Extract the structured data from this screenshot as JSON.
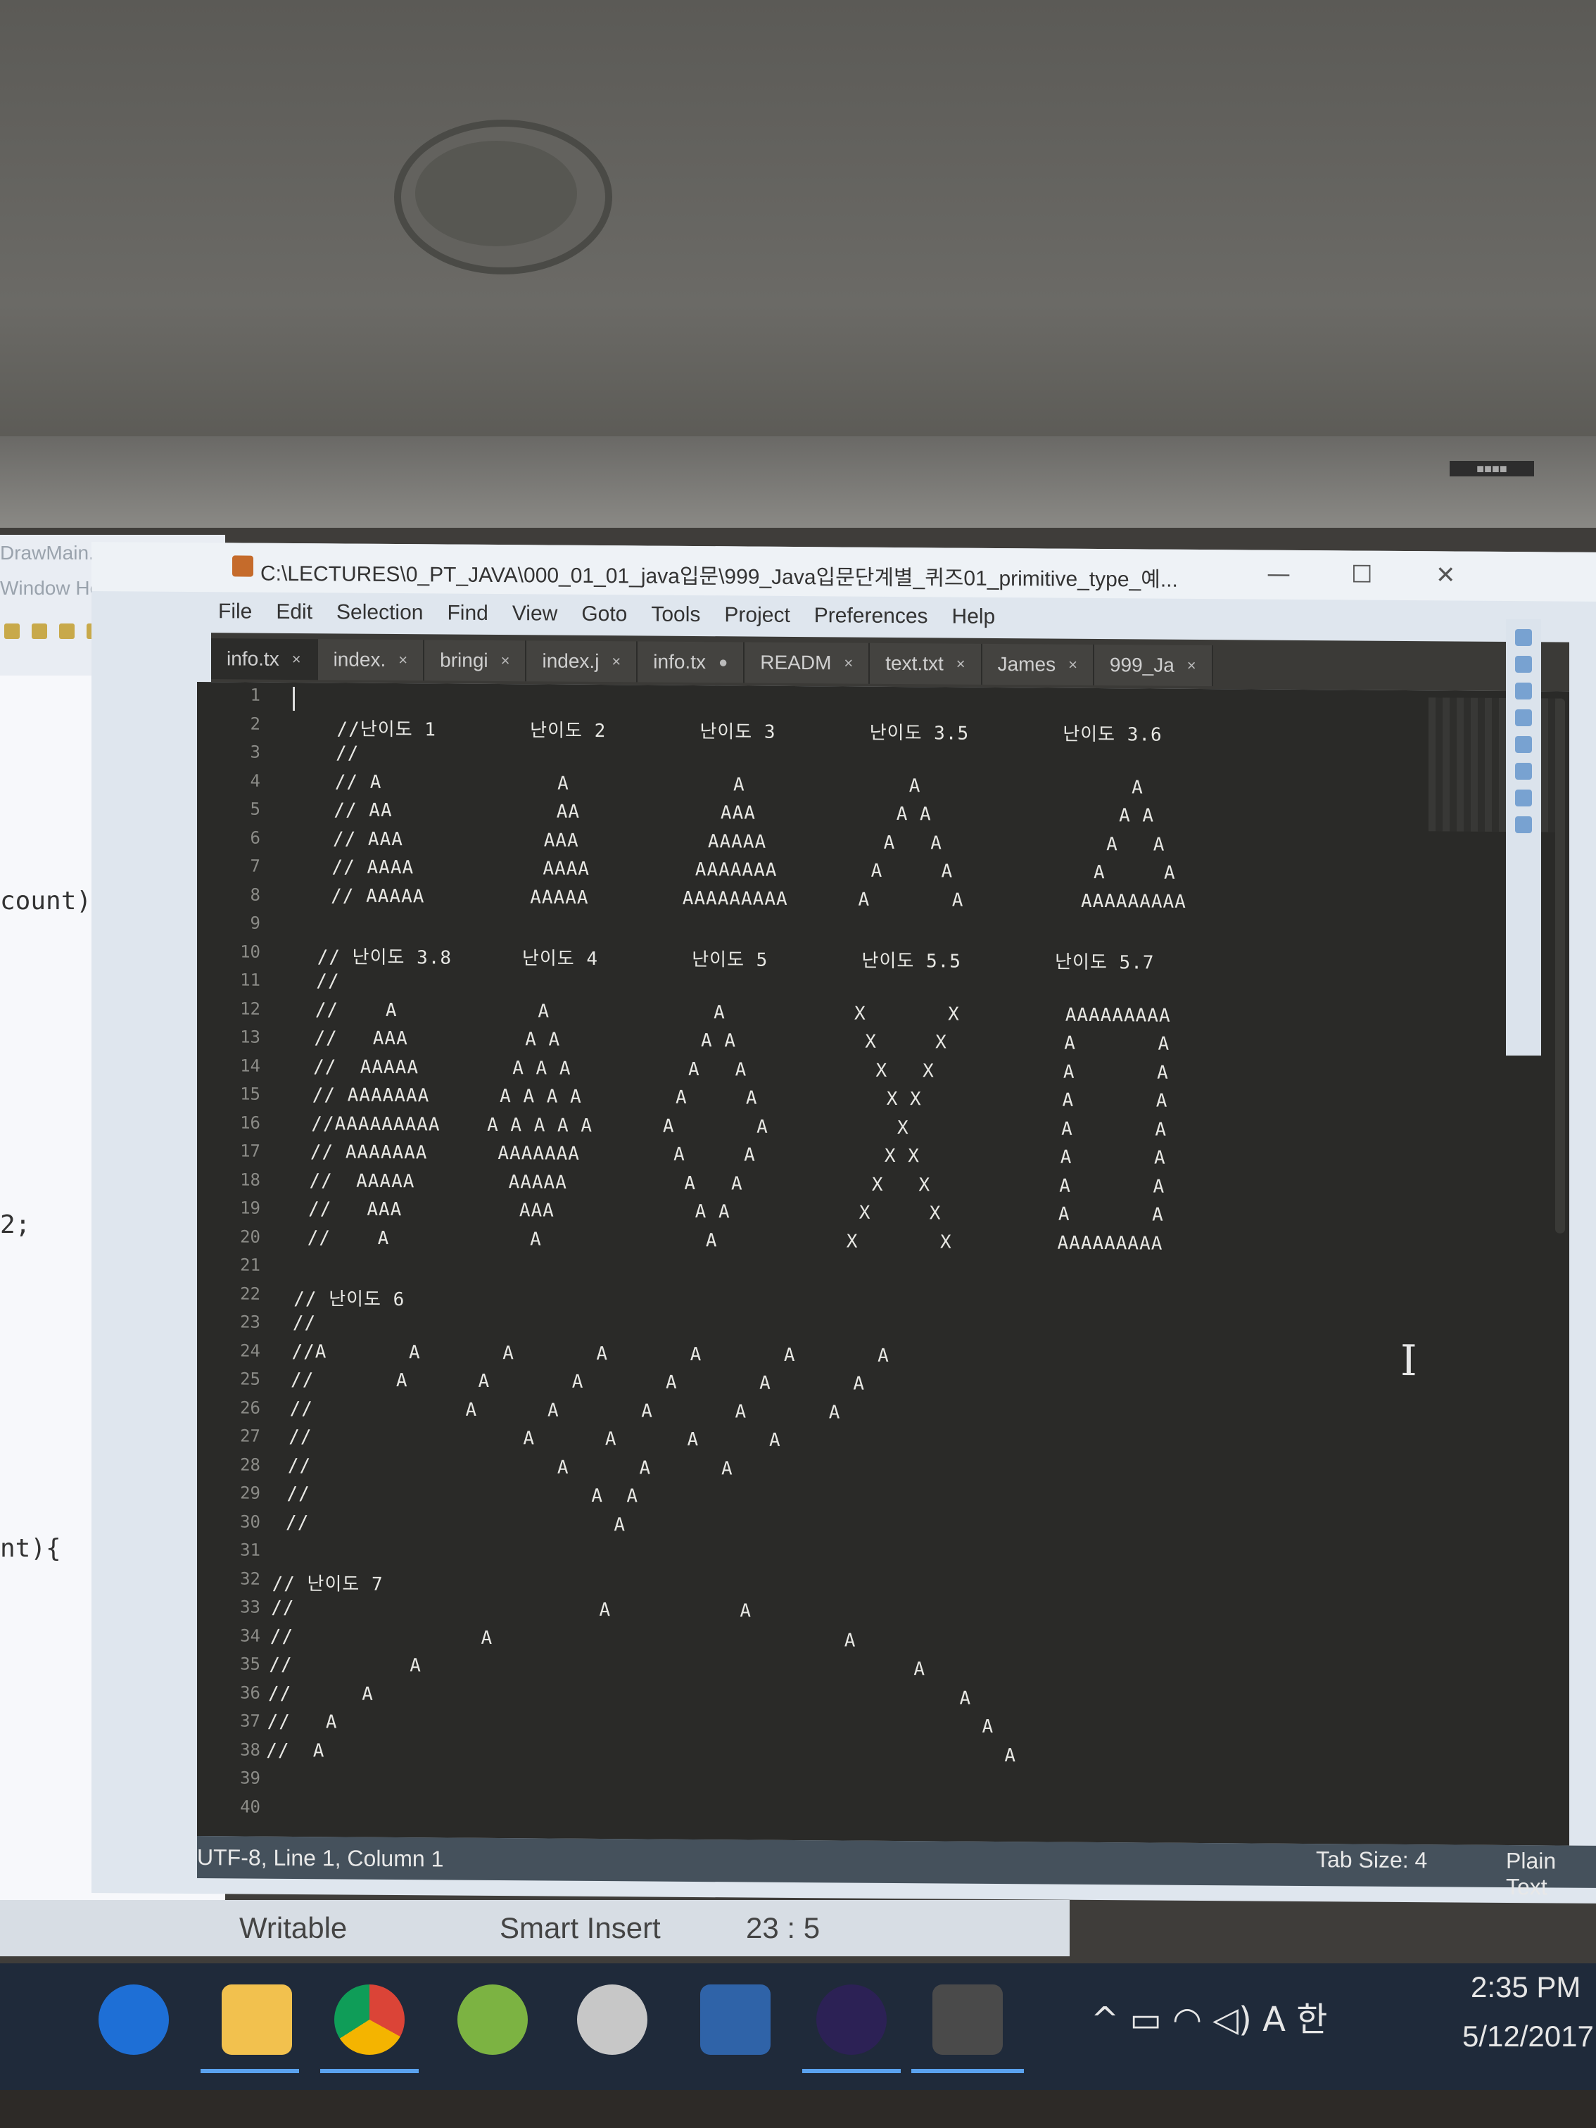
{
  "eclipse": {
    "title": "DrawMain.java - Eclip",
    "menu": "Window  Help",
    "code_fragments": [
      "count){",
      "2;",
      "nt){"
    ]
  },
  "window": {
    "title": "C:\\LECTURES\\0_PT_JAVA\\000_01_01_java입문\\999_Java입문단계별_퀴즈01_primitive_type_예...",
    "minimize": "—",
    "maximize": "☐",
    "close": "✕"
  },
  "menu": [
    "File",
    "Edit",
    "Selection",
    "Find",
    "View",
    "Goto",
    "Tools",
    "Project",
    "Preferences",
    "Help"
  ],
  "tabs": [
    {
      "label": "info.tx",
      "mark": "×"
    },
    {
      "label": "index.",
      "mark": "×"
    },
    {
      "label": "bringi",
      "mark": "×"
    },
    {
      "label": "index.j",
      "mark": "×"
    },
    {
      "label": "info.tx",
      "mark": "●"
    },
    {
      "label": "READM",
      "mark": "×"
    },
    {
      "label": "text.txt",
      "mark": "×"
    },
    {
      "label": "James",
      "mark": "×"
    },
    {
      "label": "999_Ja",
      "mark": "×"
    }
  ],
  "editor": {
    "line_numbers": [
      "1",
      "2",
      "3",
      "4",
      "5",
      "6",
      "7",
      "8",
      "9",
      "10",
      "11",
      "12",
      "13",
      "14",
      "15",
      "16",
      "17",
      "18",
      "19",
      "20",
      "21",
      "22",
      "23",
      "24",
      "25",
      "26",
      "27",
      "28",
      "29",
      "30",
      "31",
      "32",
      "33",
      "34",
      "35",
      "36",
      "37",
      "38",
      "39",
      "40"
    ],
    "lines": [
      "",
      "   //난이도 1        난이도 2        난이도 3        난이도 3.5        난이도 3.6",
      "   //",
      "   // A               A              A              A                  A",
      "   // AA              AA            AAA            A A                A A",
      "   // AAA            AAA           AAAAA          A   A              A   A",
      "   // AAAA           AAAA         AAAAAAA        A     A            A     A",
      "   // AAAAA         AAAAA        AAAAAAAAA      A       A          AAAAAAAAA",
      "",
      "  // 난이도 3.8      난이도 4        난이도 5        난이도 5.5        난이도 5.7",
      "  //",
      "  //    A            A              A           X       X         AAAAAAAAA",
      "  //   AAA          A A            A A           X     X          A       A",
      "  //  AAAAA        A A A          A   A           X   X           A       A",
      "  // AAAAAAA      A A A A        A     A           X X            A       A",
      "  //AAAAAAAAA    A A A A A      A       A           X             A       A",
      "  // AAAAAAA      AAAAAAA        A     A           X X            A       A",
      "  //  AAAAA        AAAAA          A   A           X   X           A       A",
      "  //   AAA          AAA            A A           X     X          A       A",
      "  //    A            A              A           X       X         AAAAAAAAA",
      "",
      " // 난이도 6",
      " //",
      " //A       A       A       A       A       A       A",
      " //       A      A       A       A       A       A",
      " //             A      A       A       A       A",
      " //                  A      A      A      A",
      " //                     A      A      A",
      " //                        A  A",
      " //                          A",
      "",
      "// 난이도 7",
      "//                          A           A",
      "//                A                              A",
      "//          A                                          A",
      "//      A                                                  A",
      "//   A                                                       A",
      "//  A                                                          A",
      "",
      ""
    ]
  },
  "statusbar": {
    "left": "UTF-8, Line 1, Column 1",
    "tab_size": "Tab Size: 4",
    "syntax": "Plain Text"
  },
  "eclipse_status": {
    "writable": "Writable",
    "insert_mode": "Smart Insert",
    "position": "23 : 5"
  },
  "taskbar": {
    "apps": [
      "edge-icon",
      "file-explorer-icon",
      "chrome-icon",
      "android-studio-icon",
      "paint-icon",
      "mysql-workbench-icon",
      "eclipse-icon",
      "sublime-text-icon"
    ],
    "tray": "^  ▭  ◠  ◁)  A  한",
    "time": "2:35 PM",
    "date": "5/12/2017"
  },
  "colors": {
    "editor_bg": "#2a2a28",
    "status_bg": "#45515c",
    "taskbar_bg": "#1f2a3a",
    "accent": "#5aa2ef"
  }
}
